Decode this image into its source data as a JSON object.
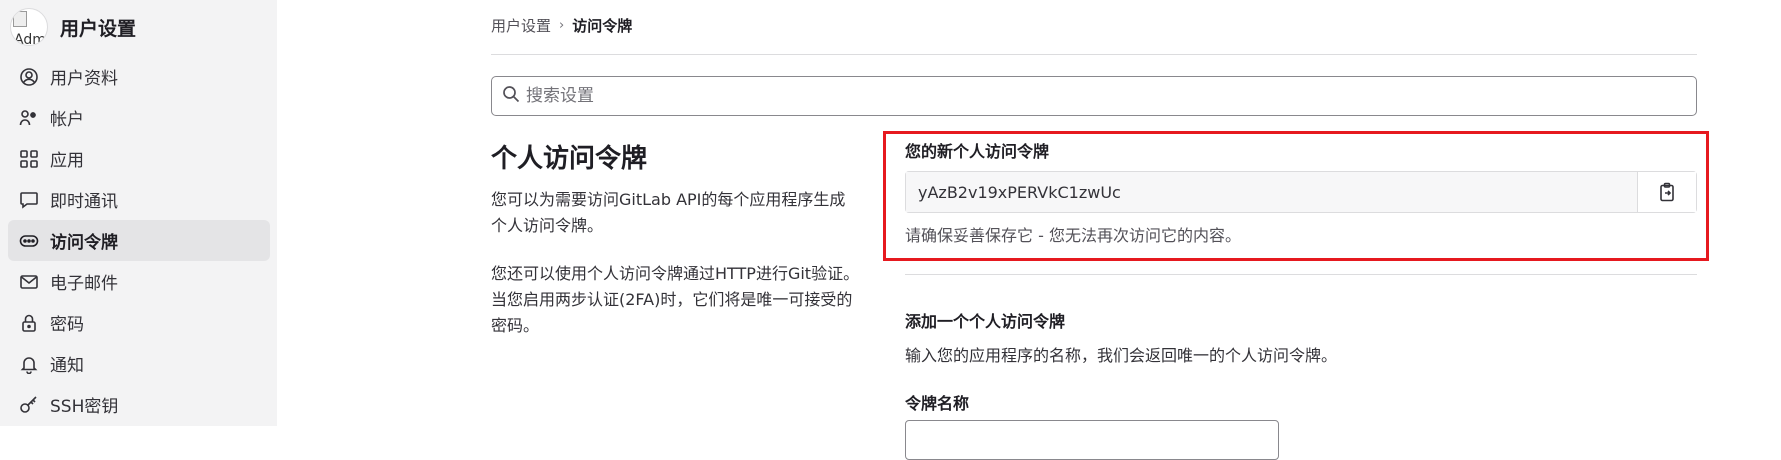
{
  "sidebar": {
    "avatar_alt": "Adm",
    "title": "用户设置",
    "items": [
      {
        "label": "用户资料",
        "icon": "user-circle-icon"
      },
      {
        "label": "帐户",
        "icon": "account-icon"
      },
      {
        "label": "应用",
        "icon": "applications-grid-icon"
      },
      {
        "label": "即时通讯",
        "icon": "chat-icon"
      },
      {
        "label": "访问令牌",
        "icon": "token-icon",
        "active": true
      },
      {
        "label": "电子邮件",
        "icon": "mail-icon"
      },
      {
        "label": "密码",
        "icon": "lock-icon"
      },
      {
        "label": "通知",
        "icon": "bell-icon"
      },
      {
        "label": "SSH密钥",
        "icon": "key-icon"
      }
    ]
  },
  "breadcrumb": {
    "parent": "用户设置",
    "separator": "›",
    "current": "访问令牌"
  },
  "search": {
    "placeholder": "搜索设置"
  },
  "section": {
    "title": "个人访问令牌",
    "desc1": "您可以为需要访问GitLab API的每个应用程序生成个人访问令牌。",
    "desc2": "您还可以使用个人访问令牌通过HTTP进行Git验证。 当您启用两步认证(2FA)时，它们将是唯一可接受的密码。"
  },
  "new_token": {
    "label": "您的新个人访问令牌",
    "value": "yAzB2v19xPERVkC1zwUc",
    "note": "请确保妥善保存它 - 您无法再次访问它的内容。"
  },
  "add_token": {
    "title": "添加一个个人访问令牌",
    "desc": "输入您的应用程序的名称，我们会返回唯一的个人访问令牌。",
    "name_label": "令牌名称"
  },
  "colors": {
    "highlight": "#e6191f",
    "sidebar_bg": "#f3f3f4",
    "active_bg": "#e4e4e6"
  }
}
